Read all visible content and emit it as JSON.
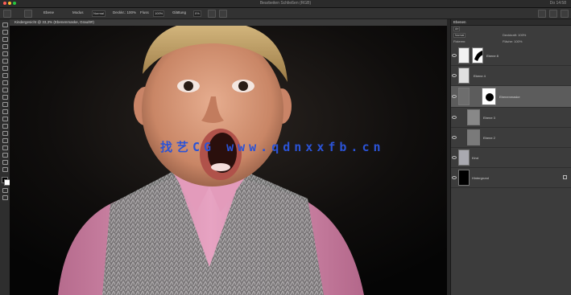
{
  "window": {
    "title": "Bearbeiten Schließen (RGB)",
    "right_status": "Do 14:58",
    "traffic_colors": [
      "#ff5f57",
      "#febc2e",
      "#28c840"
    ]
  },
  "options_bar": {
    "items": [
      "Ebene",
      "Modus",
      "Normal",
      "Deckkr.: 100%",
      "Fluss",
      "100%",
      "Glättung",
      "0%"
    ]
  },
  "document": {
    "tab_label": "Kindergesicht @ 33,3% (Ebenenmaske, Grau/8#)"
  },
  "watermark": {
    "text": "找艺CG www.qdnxxfb.cn",
    "color": "#2b53d6"
  },
  "layers_panel": {
    "title": "Ebenen",
    "search_label": "Art",
    "blend_mode": "Normal",
    "opacity_label": "Deckkraft: 100%",
    "lock_label": "Fixieren:",
    "fill_label": "Fläche: 100%",
    "layers": [
      {
        "name": "Ebene 8",
        "visible": true,
        "selected": false
      },
      {
        "name": "Ebene 4",
        "visible": true,
        "selected": false
      },
      {
        "name": "Ebenenmaske",
        "visible": true,
        "selected": true
      },
      {
        "name": "Ebene 3",
        "visible": true,
        "selected": false
      },
      {
        "name": "Ebene 2",
        "visible": true,
        "selected": false
      },
      {
        "name": "Kind",
        "visible": true,
        "selected": false
      },
      {
        "name": "Hintergrund",
        "visible": true,
        "selected": false
      }
    ]
  },
  "colors": {
    "foreground": "#000000",
    "background": "#ffffff",
    "selected_layer": "#5c5c5c"
  }
}
